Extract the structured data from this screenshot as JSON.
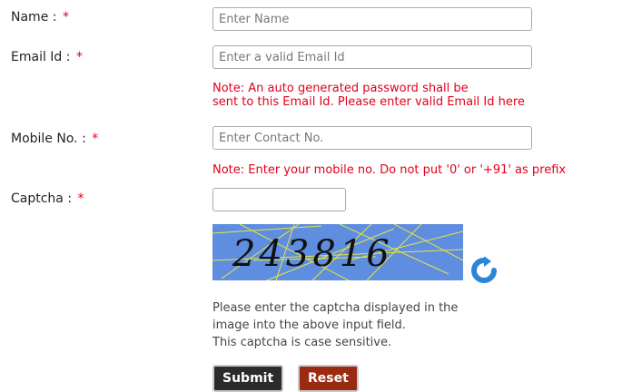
{
  "form": {
    "name": {
      "label": "Name :",
      "required_mark": "*",
      "placeholder": "Enter Name"
    },
    "email": {
      "label": "Email Id :",
      "required_mark": "*",
      "placeholder": "Enter a valid Email Id",
      "note_line1": "Note: An auto generated password shall be",
      "note_line2": "sent to this Email Id. Please enter valid Email Id here"
    },
    "mobile": {
      "label": "Mobile No. :",
      "required_mark": "*",
      "placeholder": "Enter Contact No.",
      "note": "Note: Enter your mobile no. Do not put '0' or '+91' as prefix"
    },
    "captcha": {
      "label": "Captcha :",
      "required_mark": "*",
      "value": "",
      "code": "243816",
      "help_line1": "Please enter the captcha displayed in the",
      "help_line2": "image into the above input field.",
      "help_line3": "This captcha is case sensitive."
    }
  },
  "buttons": {
    "submit": "Submit",
    "reset": "Reset"
  },
  "icons": {
    "refresh": "refresh-icon"
  },
  "colors": {
    "required": "#e0001b",
    "captcha_bg": "#5f8de0",
    "submit_bg": "#2b2b2b",
    "reset_bg": "#9b2a12"
  }
}
